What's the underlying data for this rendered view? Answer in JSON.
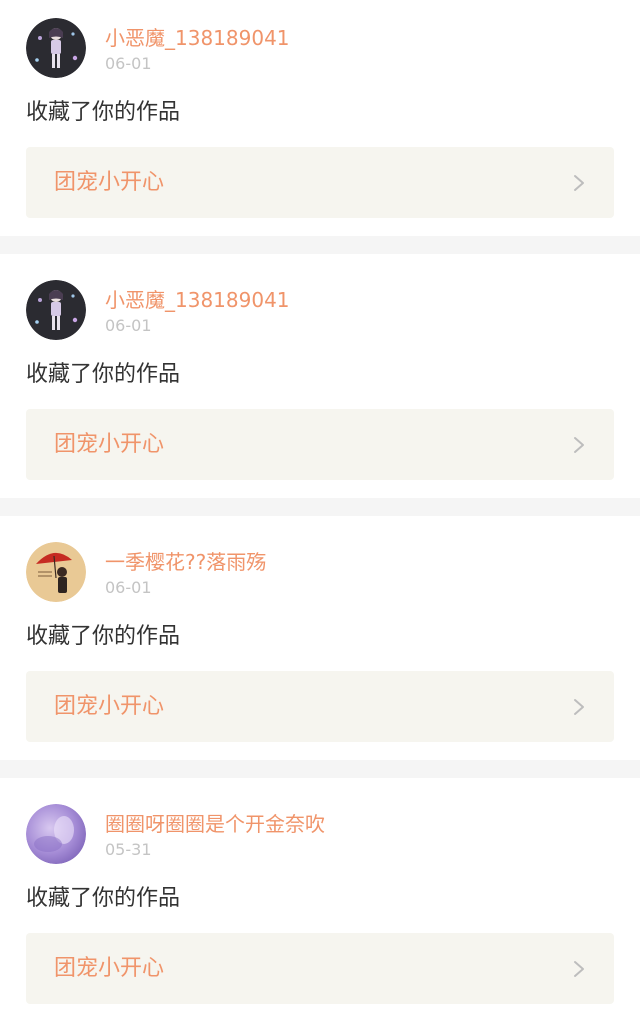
{
  "notifications": [
    {
      "username": "小恶魔_138189041",
      "date": "06-01",
      "action": "收藏了你的作品",
      "work_title": "团宠小开心",
      "avatar": "avatar-dark-girl"
    },
    {
      "username": "小恶魔_138189041",
      "date": "06-01",
      "action": "收藏了你的作品",
      "work_title": "团宠小开心",
      "avatar": "avatar-dark-girl"
    },
    {
      "username": "一季樱花??落雨殇",
      "date": "06-01",
      "action": "收藏了你的作品",
      "work_title": "团宠小开心",
      "avatar": "avatar-umbrella-girl"
    },
    {
      "username": "圈圈呀圈圈是个开金奈吹",
      "date": "05-31",
      "action": "收藏了你的作品",
      "work_title": "团宠小开心",
      "avatar": "avatar-purple-blur"
    }
  ],
  "colors": {
    "accent": "#f0946a",
    "date": "#c4c4c4",
    "action_text": "#333333",
    "link_background": "#f6f5ef",
    "divider": "#f5f5f5"
  },
  "icons": {
    "chevron": "chevron-right-icon"
  }
}
